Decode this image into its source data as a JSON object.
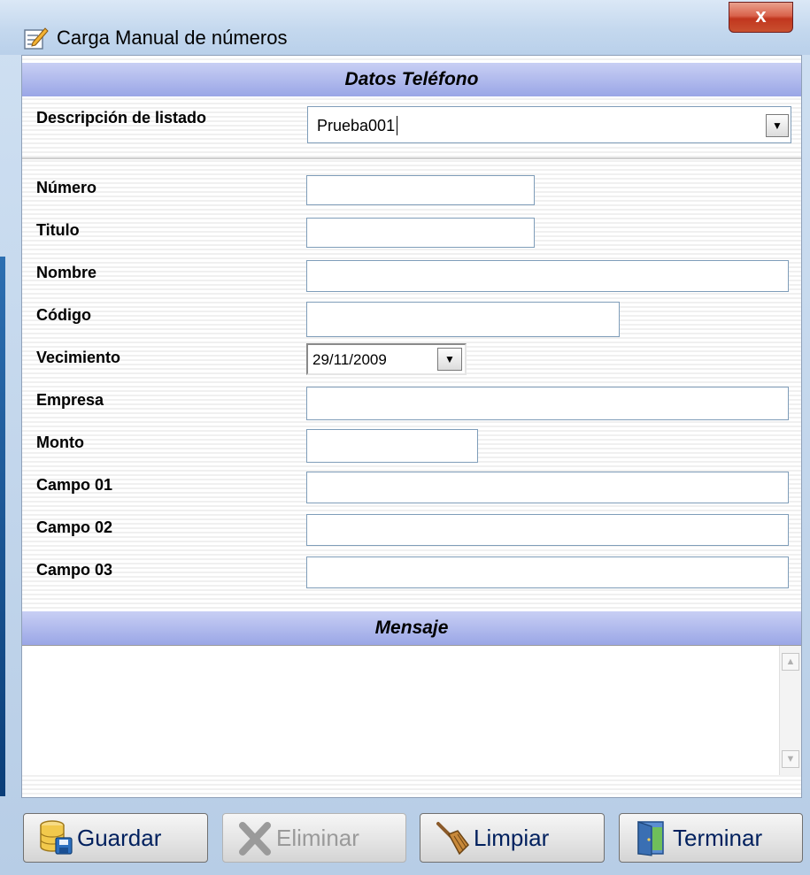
{
  "window": {
    "title": "Carga Manual de números",
    "close_label": "x"
  },
  "sections": {
    "phone_header": "Datos Teléfono",
    "message_header": "Mensaje"
  },
  "list_selector": {
    "label": "Descripción de listado",
    "value": "Prueba001"
  },
  "fields": {
    "numero": {
      "label": "Número",
      "value": ""
    },
    "titulo": {
      "label": "Titulo",
      "value": ""
    },
    "nombre": {
      "label": "Nombre",
      "value": ""
    },
    "codigo": {
      "label": "Código",
      "value": ""
    },
    "vencimiento": {
      "label": "Vecimiento",
      "value": "29/11/2009"
    },
    "empresa": {
      "label": "Empresa",
      "value": ""
    },
    "monto": {
      "label": "Monto",
      "value": ""
    },
    "campo01": {
      "label": "Campo 01",
      "value": ""
    },
    "campo02": {
      "label": "Campo 02",
      "value": ""
    },
    "campo03": {
      "label": "Campo 03",
      "value": ""
    }
  },
  "message": {
    "value": ""
  },
  "buttons": {
    "guardar": {
      "label": "Guardar",
      "icon": "database-save-icon",
      "enabled": true
    },
    "eliminar": {
      "label": "Eliminar",
      "icon": "x-delete-icon",
      "enabled": false
    },
    "limpiar": {
      "label": "Limpiar",
      "icon": "broom-icon",
      "enabled": true
    },
    "terminar": {
      "label": "Terminar",
      "icon": "exit-door-icon",
      "enabled": true
    }
  },
  "colors": {
    "section_header": "#9aa6e6",
    "button_text": "#00205e",
    "close_button": "#c1361e"
  }
}
